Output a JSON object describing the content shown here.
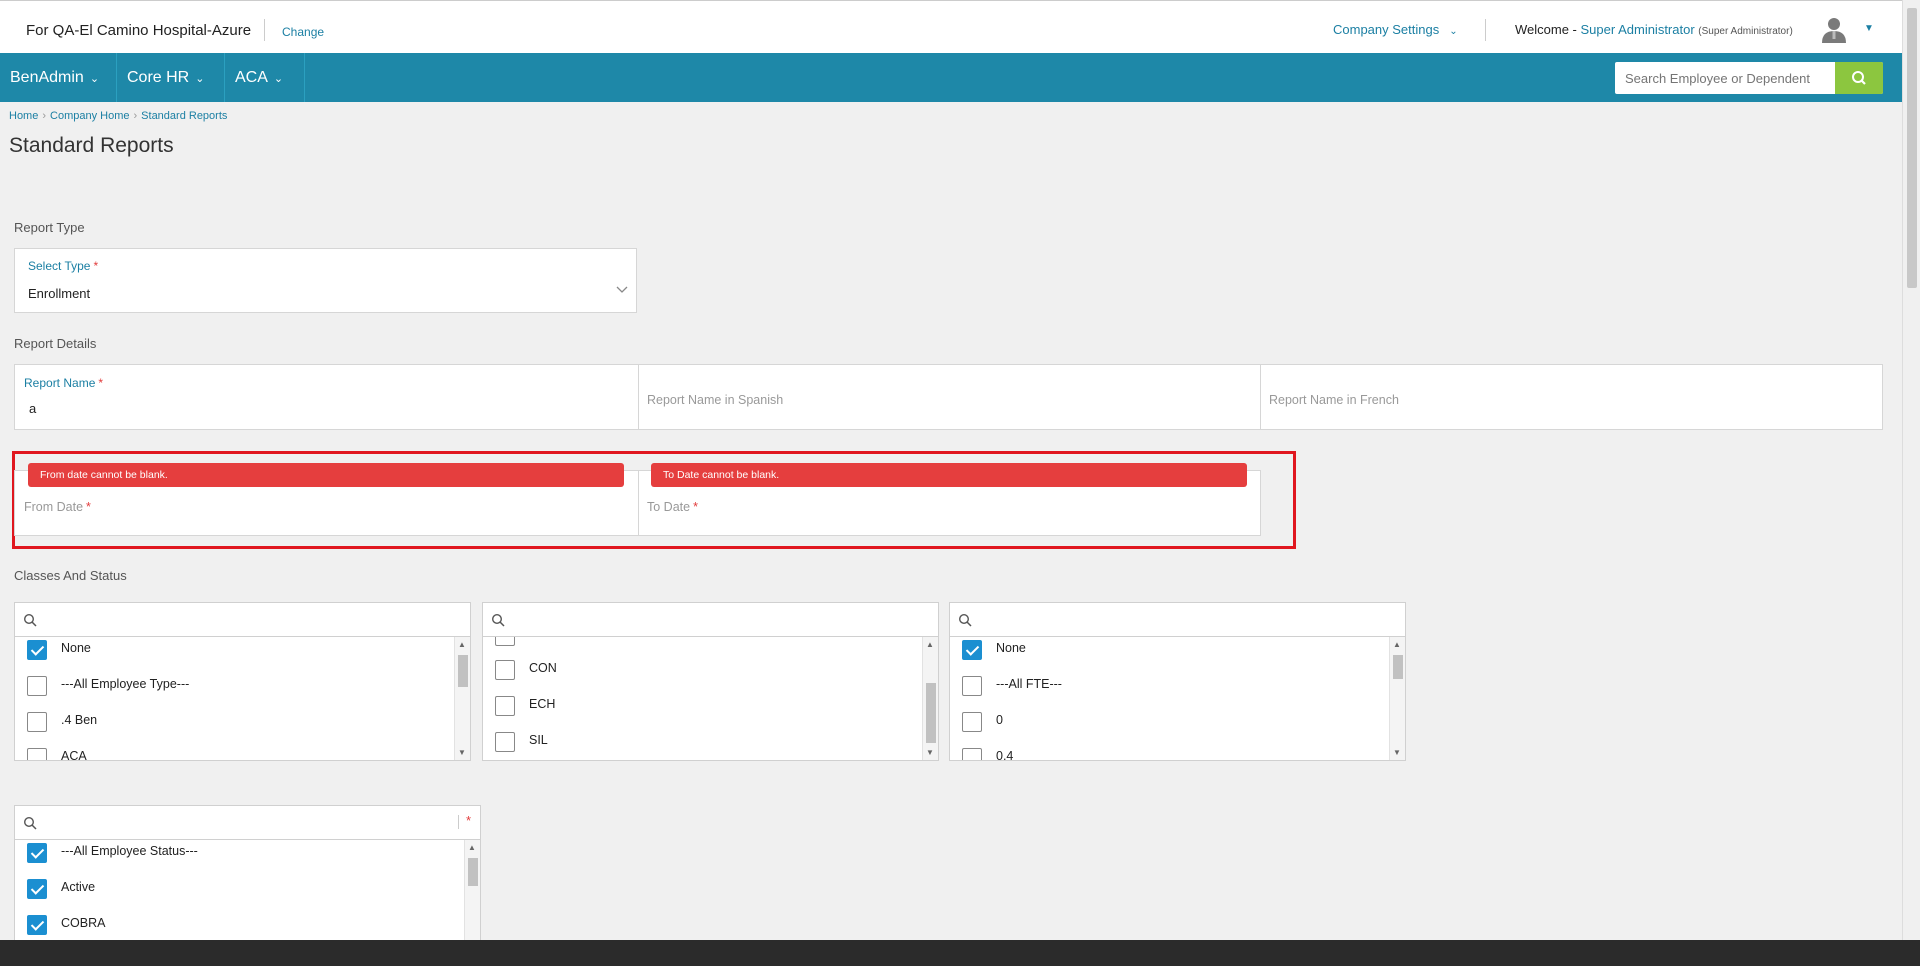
{
  "header": {
    "company": "For QA-El Camino Hospital-Azure",
    "change_label": "Change",
    "company_settings": "Company Settings",
    "welcome_prefix": "Welcome - ",
    "user_name": "Super Administrator",
    "user_role": "(Super Administrator)"
  },
  "nav": {
    "items": [
      {
        "label": "BenAdmin"
      },
      {
        "label": "Core HR"
      },
      {
        "label": "ACA"
      }
    ],
    "search_placeholder": "Search Employee or Dependent"
  },
  "breadcrumb": [
    "Home",
    "Company Home",
    "Standard Reports"
  ],
  "page_title": "Standard Reports",
  "report_type": {
    "section": "Report Type",
    "label": "Select Type",
    "value": "Enrollment"
  },
  "report_details": {
    "section": "Report Details",
    "name_label": "Report Name",
    "name_value": "a",
    "spanish_placeholder": "Report Name in Spanish",
    "french_placeholder": "Report Name in French"
  },
  "dates": {
    "from_error": "From date cannot be blank.",
    "to_error": "To Date cannot be blank.",
    "from_label": "From Date",
    "to_label": "To Date"
  },
  "classes": {
    "section": "Classes And Status",
    "list1": [
      {
        "label": "None",
        "checked": true
      },
      {
        "label": "---All Employee Type---",
        "checked": false
      },
      {
        "label": ".4 Ben",
        "checked": false
      },
      {
        "label": "ACA",
        "checked": false
      }
    ],
    "list2": [
      {
        "label": "",
        "checked": false
      },
      {
        "label": "CON",
        "checked": false
      },
      {
        "label": "ECH",
        "checked": false
      },
      {
        "label": "SIL",
        "checked": false
      }
    ],
    "list3": [
      {
        "label": "None",
        "checked": true
      },
      {
        "label": "---All FTE---",
        "checked": false
      },
      {
        "label": "0",
        "checked": false
      },
      {
        "label": "0.4",
        "checked": false
      }
    ],
    "list4": [
      {
        "label": "---All Employee Status---",
        "checked": true
      },
      {
        "label": "Active",
        "checked": true
      },
      {
        "label": "COBRA",
        "checked": true
      }
    ]
  },
  "required_mark": "*"
}
